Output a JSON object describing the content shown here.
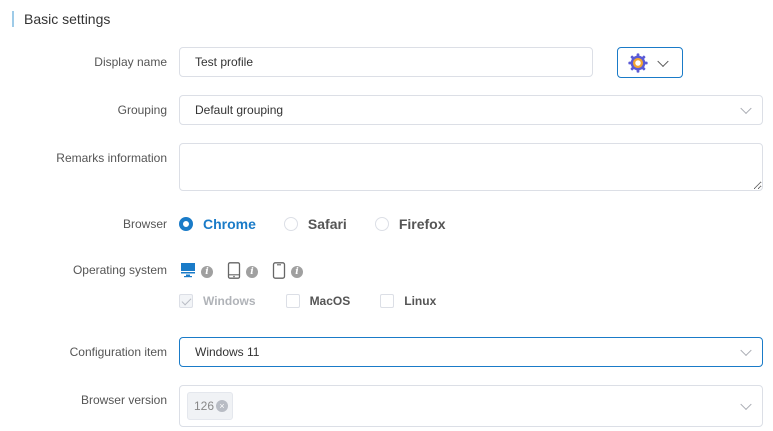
{
  "section": {
    "title": "Basic settings"
  },
  "labels": {
    "display_name": "Display name",
    "grouping": "Grouping",
    "remarks": "Remarks information",
    "browser": "Browser",
    "os": "Operating system",
    "config": "Configuration item",
    "browser_version": "Browser version"
  },
  "display_name": {
    "value": "Test profile"
  },
  "grouping": {
    "value": "Default grouping"
  },
  "remarks": {
    "value": ""
  },
  "browser": {
    "options": [
      "Chrome",
      "Safari",
      "Firefox"
    ],
    "selected": "Chrome"
  },
  "os": {
    "device_types": [
      {
        "icon": "desktop-icon",
        "selected": true
      },
      {
        "icon": "tablet-icon",
        "selected": false
      },
      {
        "icon": "phone-icon",
        "selected": false
      }
    ],
    "options": [
      "Windows",
      "MacOS",
      "Linux"
    ],
    "selected": "Windows"
  },
  "config": {
    "value": "Windows 11"
  },
  "browser_version": {
    "tags": [
      "126"
    ]
  },
  "colors": {
    "accent": "#1a7bc8",
    "border": "#dcdfe6",
    "title_bar": "#9ecbe8"
  },
  "icons": {
    "profile": "gear-icon"
  }
}
